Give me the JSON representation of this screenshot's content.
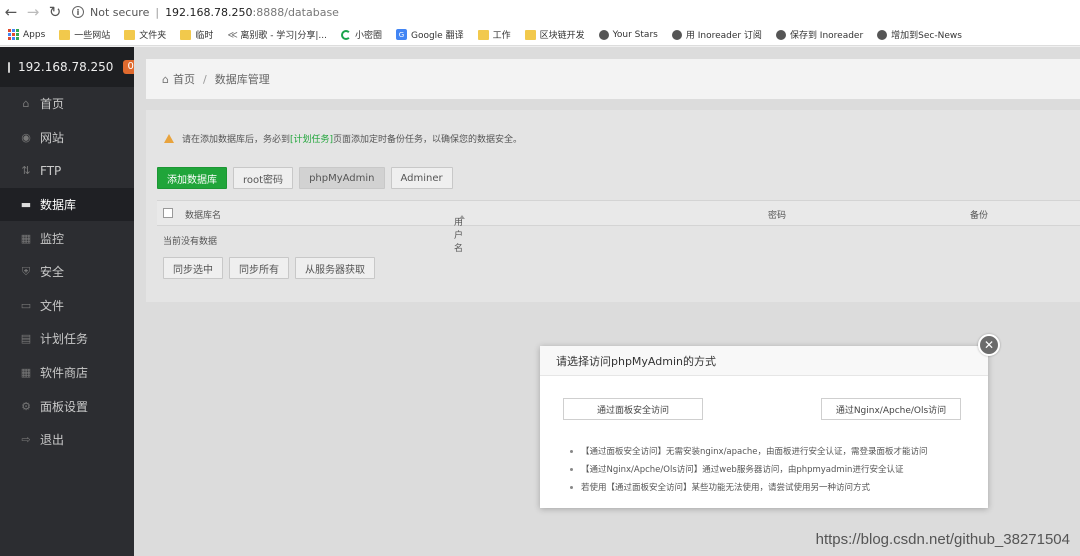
{
  "browser": {
    "security_label": "Not secure",
    "url_host": "192.168.78.250",
    "url_path": ":8888/database",
    "bookmarks": [
      {
        "label": "Apps",
        "icon": "apps-grid-icon"
      },
      {
        "label": "一些网站",
        "icon": "folder-icon"
      },
      {
        "label": "文件夹",
        "icon": "folder-icon"
      },
      {
        "label": "临时",
        "icon": "folder-icon"
      },
      {
        "label": "离别歌 - 学习|分享|...",
        "icon": "tool-icon"
      },
      {
        "label": "小密圈",
        "icon": "ring-icon"
      },
      {
        "label": "Google 翻译",
        "icon": "translate-icon"
      },
      {
        "label": "工作",
        "icon": "folder-icon"
      },
      {
        "label": "区块链开发",
        "icon": "folder-icon"
      },
      {
        "label": "Your Stars",
        "icon": "github-icon"
      },
      {
        "label": "用 Inoreader 订阅",
        "icon": "globe-icon"
      },
      {
        "label": "保存到 Inoreader",
        "icon": "globe-icon"
      },
      {
        "label": "增加到Sec-News",
        "icon": "globe-icon"
      }
    ]
  },
  "sidebar": {
    "host": "192.168.78.250",
    "badge": "0",
    "items": [
      {
        "label": "首页",
        "icon": "home-icon"
      },
      {
        "label": "网站",
        "icon": "globe-icon"
      },
      {
        "label": "FTP",
        "icon": "ftp-icon"
      },
      {
        "label": "数据库",
        "icon": "database-icon",
        "active": true
      },
      {
        "label": "监控",
        "icon": "monitor-icon"
      },
      {
        "label": "安全",
        "icon": "shield-icon"
      },
      {
        "label": "文件",
        "icon": "folder-icon"
      },
      {
        "label": "计划任务",
        "icon": "task-icon"
      },
      {
        "label": "软件商店",
        "icon": "apps-icon"
      },
      {
        "label": "面板设置",
        "icon": "gear-icon"
      },
      {
        "label": "退出",
        "icon": "logout-icon"
      }
    ]
  },
  "breadcrumb": {
    "home": "首页",
    "current": "数据库管理"
  },
  "warning": {
    "before": "请在添加数据库后，务必到",
    "link": "[计划任务]",
    "after": "页面添加定时备份任务，以确保您的数据安全。"
  },
  "toolbar": {
    "add_db": "添加数据库",
    "root_pwd": "root密码",
    "phpmyadmin": "phpMyAdmin",
    "adminer": "Adminer"
  },
  "table": {
    "columns": [
      "数据库名",
      "用户名",
      "密码",
      "备份"
    ],
    "empty_text": "当前没有数据"
  },
  "sync": {
    "selected": "同步选中",
    "all": "同步所有",
    "from_server": "从服务器获取"
  },
  "modal": {
    "title": "请选择访问phpMyAdmin的方式",
    "btn_panel": "通过面板安全访问",
    "btn_nginx": "通过Nginx/Apche/Ols访问",
    "notes": [
      "【通过面板安全访问】无需安装nginx/apache，由面板进行安全认证，需登录面板才能访问",
      "【通过Nginx/Apche/Ols访问】通过web服务器访问，由phpmyadmin进行安全认证",
      "若使用【通过面板安全访问】某些功能无法使用，请尝试使用另一种访问方式"
    ]
  },
  "watermark": "https://blog.csdn.net/github_38271504"
}
